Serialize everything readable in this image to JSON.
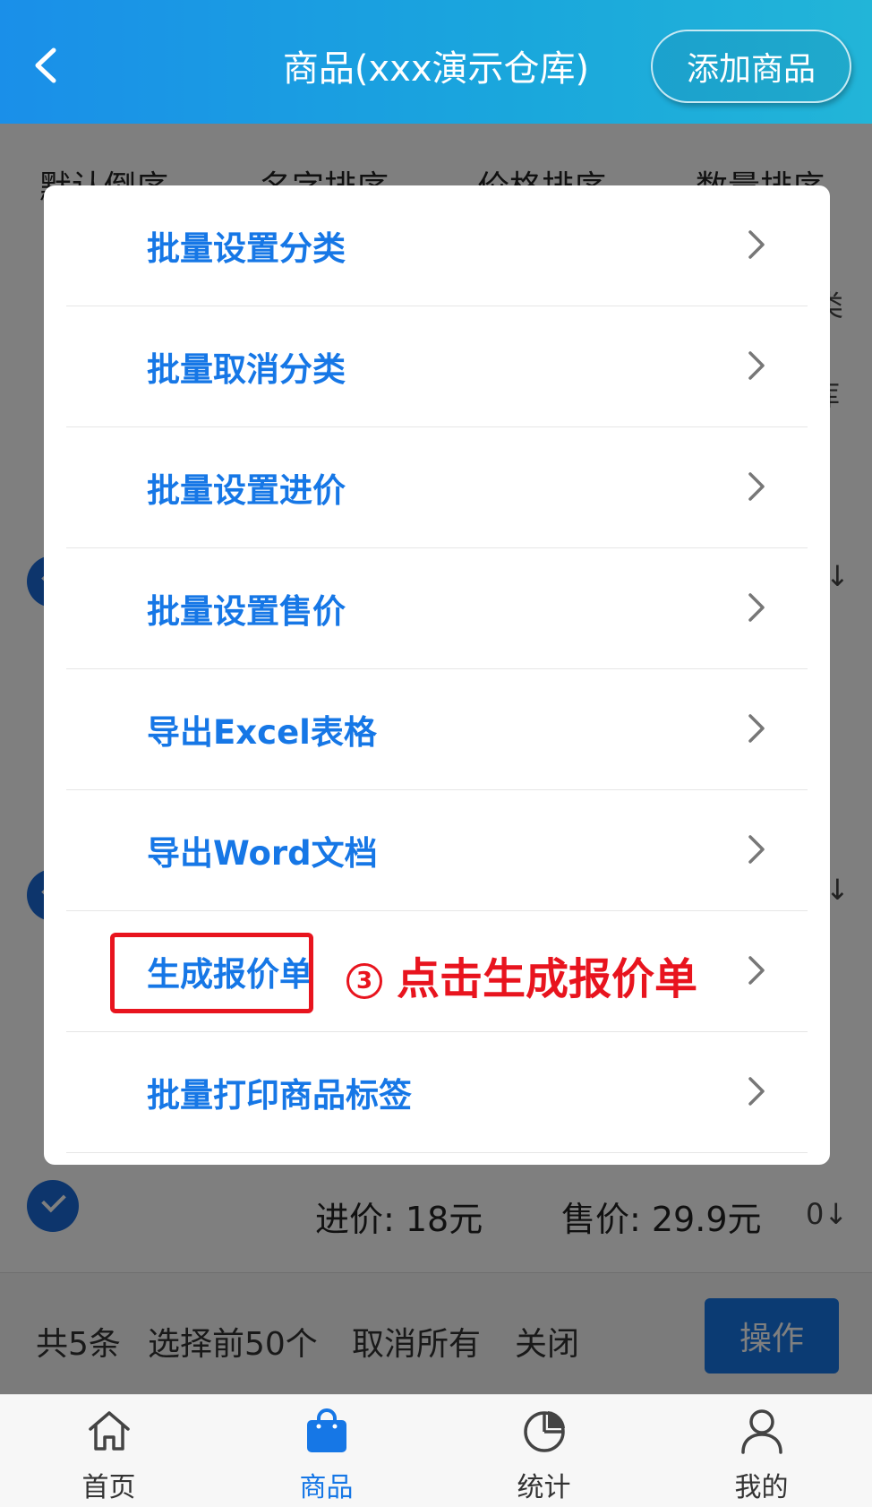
{
  "header": {
    "back_icon": "chevron-left-icon",
    "title": "商品(xxx演示仓库)",
    "add_button": "添加商品"
  },
  "sort_bar": {
    "items": [
      "默认倒序",
      "名字排序",
      "价格排序",
      "数量排序"
    ],
    "active_index": 0
  },
  "list": {
    "item": {
      "purchase_price": "进价: 18元",
      "sale_price": "售价: 29.9元",
      "right_value": "0↓"
    },
    "partial_right_labels": [
      "类",
      "库",
      "↓",
      "↓"
    ]
  },
  "action_bar": {
    "total": "共5条",
    "select_first": "选择前50个",
    "cancel_all": "取消所有",
    "close": "关闭",
    "operate_button": "操作"
  },
  "menu": {
    "items": [
      "批量设置分类",
      "批量取消分类",
      "批量设置进价",
      "批量设置售价",
      "导出Excel表格",
      "导出Word文档",
      "生成报价单",
      "批量打印商品标签"
    ],
    "highlighted_index": 6,
    "annotation_number": "3",
    "annotation_text": "点击生成报价单",
    "annotation_color": "#e8141e"
  },
  "tabbar": {
    "tabs": [
      {
        "label": "首页",
        "icon": "home-icon"
      },
      {
        "label": "商品",
        "icon": "shopping-bag-icon"
      },
      {
        "label": "统计",
        "icon": "pie-chart-icon"
      },
      {
        "label": "我的",
        "icon": "user-icon"
      }
    ],
    "active_index": 1
  },
  "colors": {
    "accent": "#1677e6",
    "header_gradient_start": "#1a8fe9",
    "header_gradient_end": "#22b5d8"
  }
}
